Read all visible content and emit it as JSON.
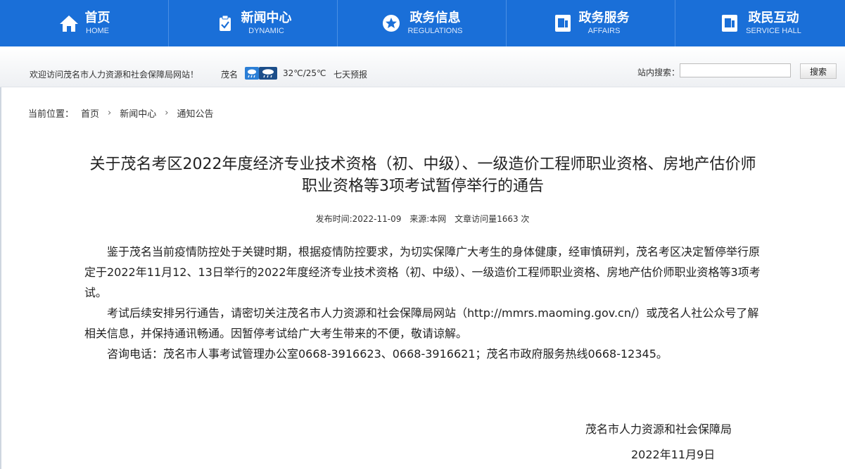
{
  "nav": [
    {
      "zh": "首页",
      "en": "HOME",
      "icon": "home-icon"
    },
    {
      "zh": "新闻中心",
      "en": "DYNAMIC",
      "icon": "clipboard-check-icon"
    },
    {
      "zh": "政务信息",
      "en": "REGULATIONS",
      "icon": "star-circle-icon"
    },
    {
      "zh": "政务服务",
      "en": "AFFAIRS",
      "icon": "document-icon"
    },
    {
      "zh": "政民互动",
      "en": "SERVICE HALL",
      "icon": "document-icon"
    }
  ],
  "topbar": {
    "welcome": "欢迎访问茂名市人力资源和社会保障局网站！",
    "city": "茂名",
    "temperature": "32℃/25℃",
    "forecast": "七天预报",
    "search_label": "站内搜索：",
    "search_value": "",
    "search_button": "搜索"
  },
  "breadcrumb": {
    "label": "当前位置：",
    "items": [
      "首页",
      "新闻中心",
      "通知公告"
    ]
  },
  "article": {
    "title": "关于茂名考区2022年度经济专业技术资格（初、中级）、一级造价工程师职业资格、房地产估价师职业资格等3项考试暂停举行的通告",
    "publish_time": "发布时间:2022-11-09",
    "source": "来源:本网",
    "views": "文章访问量1663 次",
    "paragraphs": [
      "鉴于茂名当前疫情防控处于关键时期，根据疫情防控要求，为切实保障广大考生的身体健康，经审慎研判，茂名考区决定暂停举行原定于2022年11月12、13日举行的2022年度经济专业技术资格（初、中级）、一级造价工程师职业资格、房地产估价师职业资格等3项考试。",
      "考试后续安排另行通告，请密切关注茂名市人力资源和社会保障局网站（http://mmrs.maoming.gov.cn/）或茂名人社公众号了解相关信息，并保持通讯畅通。因暂停考试给广大考生带来的不便，敬请谅解。",
      "咨询电话：茂名市人事考试管理办公室0668-3916623、0668-3916621；茂名市政府服务热线0668-12345。"
    ],
    "signature": "茂名市人力资源和社会保障局",
    "date": "2022年11月9日"
  }
}
